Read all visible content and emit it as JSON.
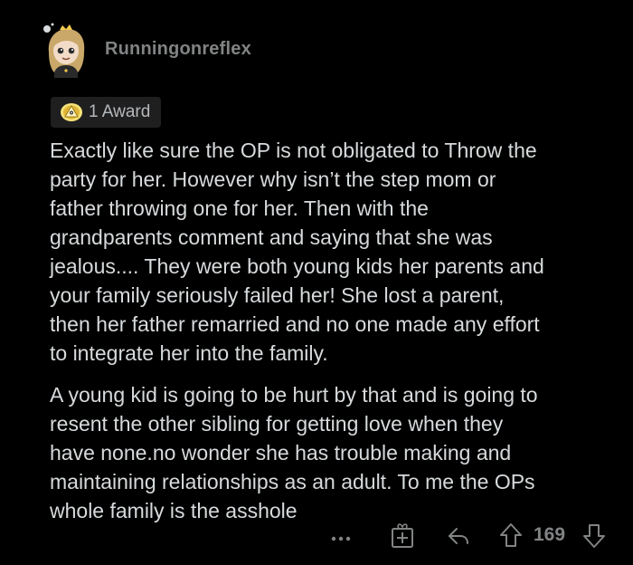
{
  "comment": {
    "username": "Runningonreflex",
    "award_label": "1 Award",
    "paragraphs": [
      "Exactly like sure the OP is not obligated to Throw the\nparty for her. However why isn’t the step mom or\nfather throwing one for her. Then with the\ngrandparents comment and saying that she was\njealous.... They were both young kids her parents and\nyour family seriously failed her! She lost a parent,\nthen her father remarried and no one made any effort\nto integrate her into the family.",
      "A young kid is going to be hurt by that and is going to\nresent the other sibling for getting love when they\nhave none.no wonder she has trouble making and\nmaintaining relationships as an adult. To me the OPs\nwhole family is the asshole"
    ],
    "vote_count": "169"
  },
  "icons": {
    "avatar": "avatar",
    "award": "award-icon",
    "more": "more-options-icon",
    "give_award": "gift-icon",
    "reply": "reply-icon",
    "upvote": "upvote-icon",
    "downvote": "downvote-icon"
  },
  "colors": {
    "background": "#000000",
    "body_text": "#d7dadc",
    "muted": "#818384",
    "badge_bg": "#1f1f20"
  }
}
